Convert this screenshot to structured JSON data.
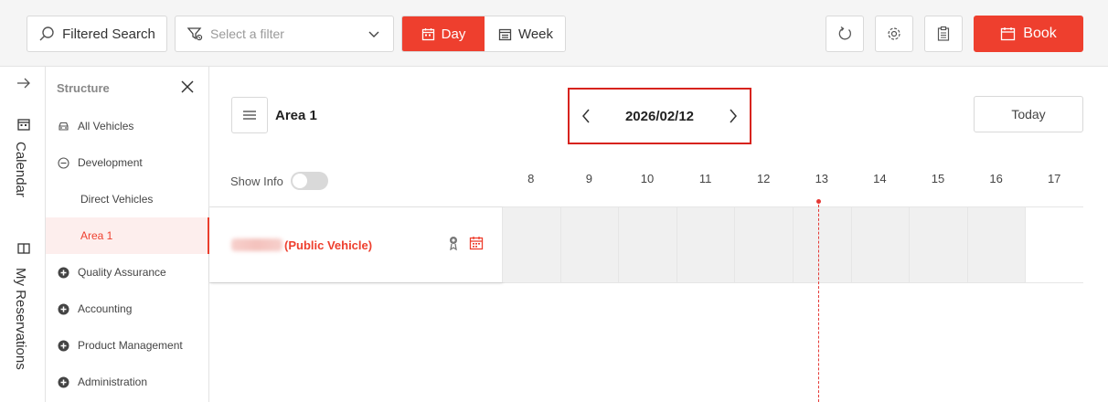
{
  "toolbar": {
    "search_label": "Filtered Search",
    "filter_placeholder": "Select a filter",
    "day_label": "Day",
    "week_label": "Week",
    "book_label": "Book"
  },
  "rail": {
    "calendar_label": "Calendar",
    "reservations_label": "My Reservations"
  },
  "structure": {
    "title": "Structure",
    "items": [
      {
        "label": "All Vehicles",
        "icon": "car-icon"
      },
      {
        "label": "Development",
        "icon": "minus-circle-icon"
      },
      {
        "label": "Direct Vehicles",
        "icon": ""
      },
      {
        "label": "Area 1",
        "icon": "",
        "active": true
      },
      {
        "label": "Quality Assurance",
        "icon": "plus-circle-icon"
      },
      {
        "label": "Accounting",
        "icon": "plus-circle-icon"
      },
      {
        "label": "Product Management",
        "icon": "plus-circle-icon"
      },
      {
        "label": "Administration",
        "icon": "plus-circle-icon"
      }
    ]
  },
  "main": {
    "area_title": "Area 1",
    "date": "2026/02/12",
    "today_label": "Today",
    "show_info_label": "Show Info",
    "hours": [
      "8",
      "9",
      "10",
      "11",
      "12",
      "13",
      "14",
      "15",
      "16",
      "17"
    ],
    "vehicle_name": "(Public Vehicle)"
  },
  "colors": {
    "accent": "#ee3f2e",
    "highlight_border": "#d7231d"
  }
}
